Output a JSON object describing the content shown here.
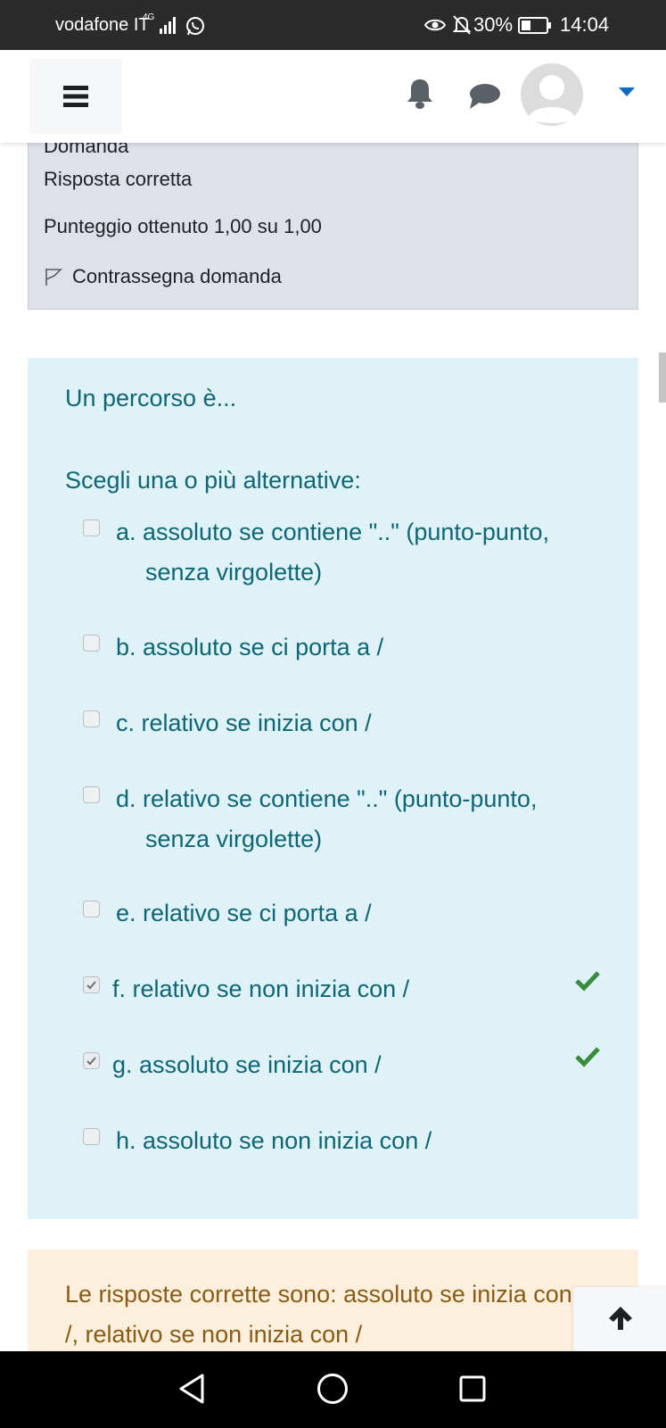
{
  "status_bar": {
    "carrier": "vodafone IT",
    "network": "4G",
    "battery": "30%",
    "time": "14:04"
  },
  "info": {
    "clipped_label": "Domanda",
    "state": "Risposta corretta",
    "grade": "Punteggio ottenuto 1,00 su 1,00",
    "flag_label": "Contrassegna domanda"
  },
  "question": {
    "text": "Un percorso è...",
    "prompt": "Scegli una o più alternative:",
    "options": [
      {
        "letter": "a.",
        "text": "assoluto se contiene \"..\" (punto-punto, senza virgolette)",
        "line1": "a. assoluto se contiene \"..\" (punto-punto,",
        "line2": "senza virgolette)",
        "checked": false,
        "correct": false
      },
      {
        "letter": "b.",
        "text": "assoluto se ci porta a /",
        "line1": "b. assoluto se ci porta a /",
        "line2": "",
        "checked": false,
        "correct": false
      },
      {
        "letter": "c.",
        "text": "relativo se inizia con /",
        "line1": "c. relativo se inizia con /",
        "line2": "",
        "checked": false,
        "correct": false
      },
      {
        "letter": "d.",
        "text": "relativo se contiene \"..\" (punto-punto, senza virgolette)",
        "line1": "d. relativo se contiene \"..\" (punto-punto,",
        "line2": "senza virgolette)",
        "checked": false,
        "correct": false
      },
      {
        "letter": "e.",
        "text": "relativo se ci porta a /",
        "line1": "e. relativo se ci porta a /",
        "line2": "",
        "checked": false,
        "correct": false
      },
      {
        "letter": "f.",
        "text": "relativo se non inizia con /",
        "line1": "f. relativo se non inizia con /",
        "line2": "",
        "checked": true,
        "correct": true
      },
      {
        "letter": "g.",
        "text": "assoluto se inizia con /",
        "line1": "g. assoluto se inizia con /",
        "line2": "",
        "checked": true,
        "correct": true
      },
      {
        "letter": "h.",
        "text": "assoluto se non inizia con /",
        "line1": "h. assoluto se non inizia con /",
        "line2": "",
        "checked": false,
        "correct": false
      }
    ]
  },
  "feedback": {
    "right_answer": "Le risposte corrette sono: assoluto se inizia con /, relativo se non inizia con /"
  },
  "icons": {
    "menu": "hamburger-icon",
    "notifications": "bell-icon",
    "messages": "chat-icon",
    "user": "avatar-icon",
    "user_menu": "caret-down-icon",
    "flag": "flag-icon",
    "correct": "check-icon",
    "back_to_top": "arrow-up-icon"
  },
  "colors": {
    "question_bg": "#def2f8",
    "question_text": "#0f6674",
    "info_bg": "#dee2e6",
    "feedback_bg": "#fcefdc",
    "feedback_text": "#8a5b14",
    "correct": "#3a8b3c",
    "caret": "#0f6cbf"
  }
}
